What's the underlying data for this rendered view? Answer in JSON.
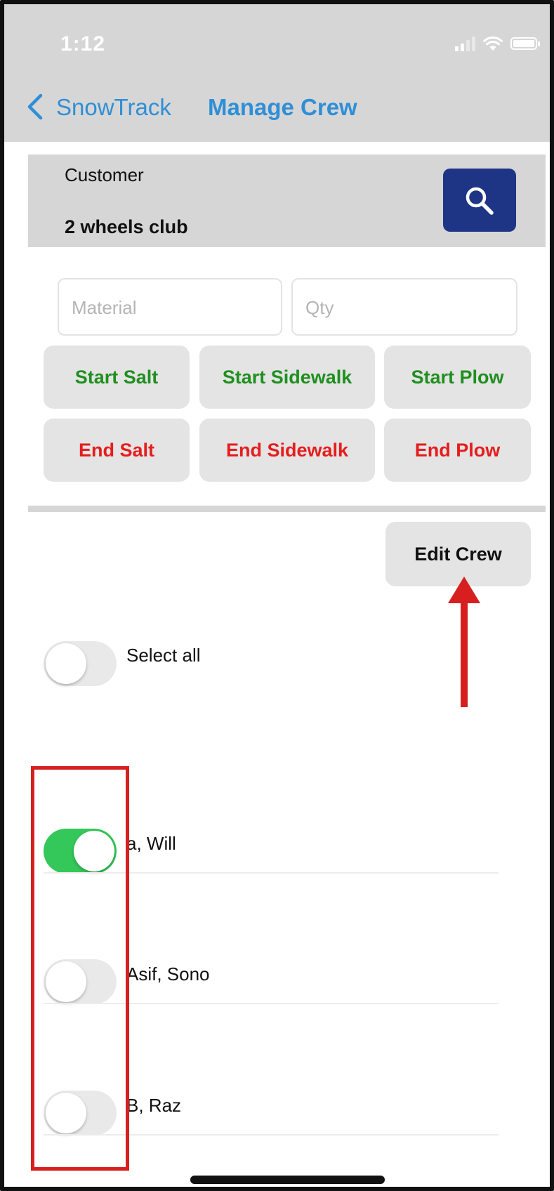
{
  "status_bar": {
    "time": "1:12"
  },
  "nav": {
    "back_label": "SnowTrack",
    "title": "Manage Crew"
  },
  "customer": {
    "label": "Customer",
    "value": "2 wheels club"
  },
  "inputs": {
    "material_placeholder": "Material",
    "qty_placeholder": "Qty"
  },
  "start_buttons": [
    "Start Salt",
    "Start Sidewalk",
    "Start Plow"
  ],
  "end_buttons": [
    "End Salt",
    "End Sidewalk",
    "End Plow"
  ],
  "edit_crew_label": "Edit Crew",
  "select_all": {
    "label": "Select all",
    "on": false
  },
  "crew": [
    {
      "name": "a, Will",
      "on": true
    },
    {
      "name": "Asif, Sono",
      "on": false
    },
    {
      "name": "B, Raz",
      "on": false
    }
  ],
  "colors": {
    "accent_blue": "#2f8fd6",
    "search_button": "#1e3585",
    "start_green": "#1f8f1f",
    "end_red": "#e51d1d",
    "toggle_on": "#34c759",
    "annotation_red": "#d81f1f"
  },
  "icons": {
    "back": "chevron-left-icon",
    "search": "magnifier-icon",
    "signal": "cellular-signal-icon",
    "wifi": "wifi-icon",
    "battery": "battery-icon",
    "annotation_arrow": "up-arrow-annotation"
  }
}
